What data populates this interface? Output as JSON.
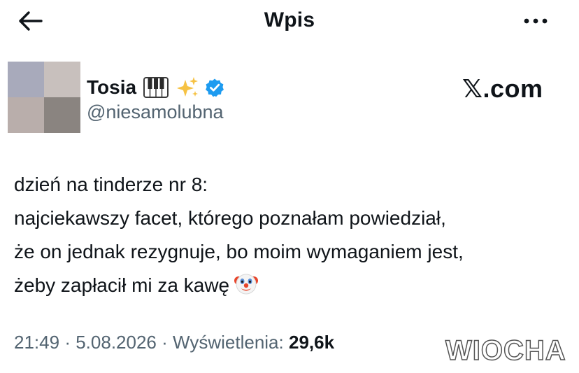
{
  "header": {
    "title": "Wpis",
    "back_icon": "arrow-left-icon",
    "more_icon": "more-horizontal-icon"
  },
  "author": {
    "name": "Tosia",
    "badges": [
      "piano-keys-emoji",
      "sparkles-emoji",
      "verified-badge-icon"
    ],
    "handle": "@niesamolubna",
    "avatar_colors": [
      "#a8aabb",
      "#c8c0bd",
      "#b9aeab",
      "#8a8480"
    ]
  },
  "source": {
    "label": "𝕏.com"
  },
  "tweet": {
    "lines": [
      "dzień na tinderze nr 8:",
      "najciekawszy facet, którego poznałam powiedział,",
      "że on jednak rezygnuje, bo moim wymaganiem jest,",
      "żeby zapłacił mi za kawę"
    ],
    "trailing_emoji": "clown-face-emoji"
  },
  "meta": {
    "time": "21:49",
    "date": "5.08.2026",
    "views_label": "Wyświetlenia:",
    "views_count": "29,6k",
    "separator": "·"
  },
  "watermark": {
    "label": "WIOCHA"
  },
  "colors": {
    "text": "#0f1419",
    "secondary": "#536471",
    "verified": "#1d9bf0",
    "watermark_accent": "#c0392b"
  }
}
